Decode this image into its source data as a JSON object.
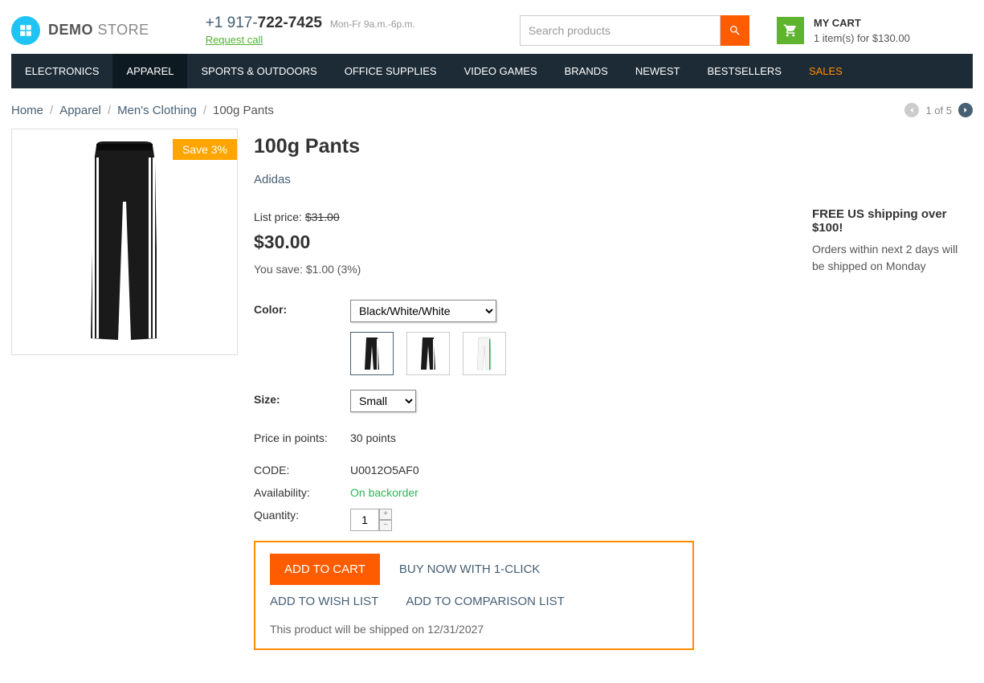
{
  "header": {
    "logo_bold": "DEMO",
    "logo_light": " STORE",
    "phone_prefix": "+1 917-",
    "phone_bold": "722-7425",
    "hours": "Mon-Fr 9a.m.-6p.m.",
    "request_call": "Request call",
    "search_placeholder": "Search products",
    "cart_title": "MY CART",
    "cart_sub": "1 item(s) for $130.00"
  },
  "nav": {
    "items": [
      "ELECTRONICS",
      "APPAREL",
      "SPORTS & OUTDOORS",
      "OFFICE SUPPLIES",
      "VIDEO GAMES",
      "BRANDS",
      "NEWEST",
      "BESTSELLERS",
      "SALES"
    ],
    "active_index": 1,
    "sales_index": 8
  },
  "breadcrumb": {
    "items": [
      "Home",
      "Apparel",
      "Men's Clothing"
    ],
    "current": "100g Pants"
  },
  "pager": {
    "text": "1 of 5"
  },
  "product": {
    "discount_badge": "Save 3%",
    "title": "100g Pants",
    "brand": "Adidas",
    "list_price_label": "List price: ",
    "list_price": "$31.00",
    "price": "$30.00",
    "savings": "You save: $1.00 (3%)",
    "color_label": "Color:",
    "color_selected": "Black/White/White",
    "size_label": "Size:",
    "size_selected": "Small",
    "points_label": "Price in points:",
    "points_value": "30 points",
    "code_label": "CODE:",
    "code_value": "U0012O5AF0",
    "avail_label": "Availability:",
    "avail_value": "On backorder",
    "qty_label": "Quantity:",
    "qty_value": "1",
    "add_to_cart": "ADD TO CART",
    "buy_now": "BUY NOW WITH 1-CLICK",
    "wishlist": "ADD TO WISH LIST",
    "compare": "ADD TO COMPARISON LIST",
    "ship_note": "This product will be shipped on 12/31/2027"
  },
  "sidebar": {
    "promo_title": "FREE US shipping over $100!",
    "promo_detail": "Orders within next 2 days will be shipped on Monday"
  }
}
